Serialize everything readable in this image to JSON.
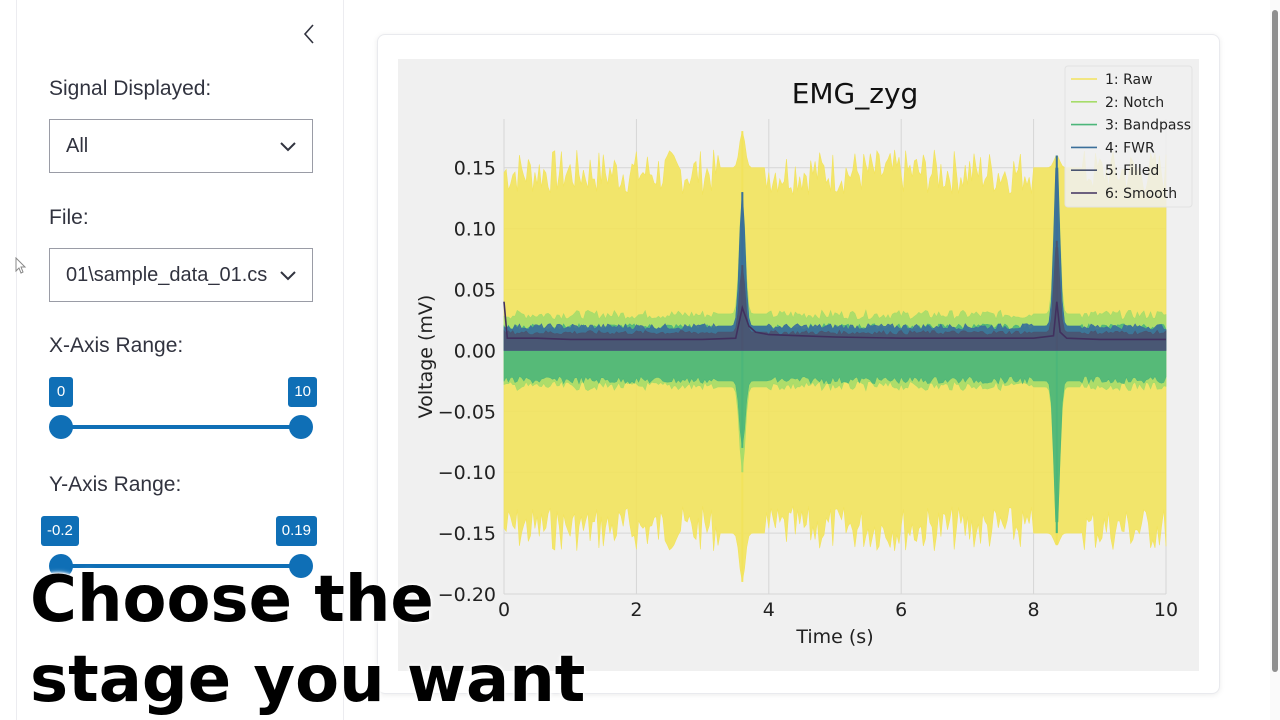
{
  "sidebar": {
    "signal_label": "Signal Displayed:",
    "signal_value": "All",
    "file_label": "File:",
    "file_value": "01\\sample_data_01.cs",
    "x_range_label": "X-Axis Range:",
    "x_range": {
      "min": "0",
      "max": "10",
      "low": 0,
      "high": 10,
      "bound_min": 0,
      "bound_max": 10
    },
    "y_range_label": "Y-Axis Range:",
    "y_range": {
      "min": "-0.2",
      "max": "0.19",
      "low": -0.2,
      "high": 0.19,
      "bound_min": -0.2,
      "bound_max": 0.19
    }
  },
  "caption": "Choose the\nstage you want",
  "chart_data": {
    "type": "line",
    "title": "EMG_zyg",
    "xlabel": "Time (s)",
    "ylabel": "Voltage (mV)",
    "xlim": [
      0,
      10
    ],
    "ylim": [
      -0.2,
      0.19
    ],
    "x_ticks": [
      "0",
      "2",
      "4",
      "6",
      "8",
      "10"
    ],
    "x_tick_values": [
      0,
      2,
      4,
      6,
      8,
      10
    ],
    "y_ticks": [
      "0.15",
      "0.10",
      "0.05",
      "0.00",
      "−0.05",
      "−0.10",
      "−0.15",
      "−0.20"
    ],
    "y_tick_values": [
      0.15,
      0.1,
      0.05,
      0.0,
      -0.05,
      -0.1,
      -0.15,
      -0.2
    ],
    "grid": true,
    "legend_position": "top-right",
    "series": [
      {
        "name": "1: Raw",
        "color": "#f2e35c",
        "band": [
          -0.15,
          0.15
        ],
        "spikes": [
          {
            "x": 3.6,
            "y": [
              -0.19,
              0.18
            ]
          },
          {
            "x": 8.35,
            "y": [
              -0.16,
              0.16
            ]
          }
        ]
      },
      {
        "name": "2: Notch",
        "color": "#a6dc6a",
        "band": [
          -0.03,
          0.03
        ],
        "spikes": [
          {
            "x": 3.6,
            "y": [
              -0.1,
              0.13
            ]
          },
          {
            "x": 8.35,
            "y": [
              -0.15,
              0.16
            ]
          }
        ]
      },
      {
        "name": "3: Bandpass",
        "color": "#4cb67a",
        "band": [
          -0.025,
          0.02
        ],
        "spikes": [
          {
            "x": 3.6,
            "y": [
              -0.08,
              0.12
            ]
          },
          {
            "x": 8.35,
            "y": [
              -0.15,
              0.15
            ]
          }
        ]
      },
      {
        "name": "4: FWR",
        "color": "#3b6f9a",
        "band": [
          0,
          0.02
        ],
        "spikes": [
          {
            "x": 3.6,
            "y": [
              0,
              0.13
            ]
          },
          {
            "x": 8.35,
            "y": [
              0,
              0.16
            ]
          }
        ]
      },
      {
        "name": "5: Filled",
        "color": "#4a5470",
        "band": [
          0,
          0.015
        ],
        "spikes": [
          {
            "x": 3.6,
            "y": [
              0,
              0.07
            ]
          },
          {
            "x": 8.35,
            "y": [
              0,
              0.09
            ]
          }
        ]
      },
      {
        "name": "6: Smooth",
        "color": "#41305e",
        "x": [
          0,
          0.05,
          0.5,
          1,
          2,
          3,
          3.5,
          3.6,
          3.7,
          3.8,
          4,
          4.5,
          5,
          6,
          7,
          8,
          8.3,
          8.35,
          8.4,
          8.5,
          9,
          10
        ],
        "y": [
          0.04,
          0.01,
          0.01,
          0.009,
          0.009,
          0.009,
          0.01,
          0.035,
          0.02,
          0.015,
          0.013,
          0.012,
          0.011,
          0.01,
          0.01,
          0.01,
          0.012,
          0.04,
          0.015,
          0.01,
          0.009,
          0.009
        ]
      }
    ]
  }
}
